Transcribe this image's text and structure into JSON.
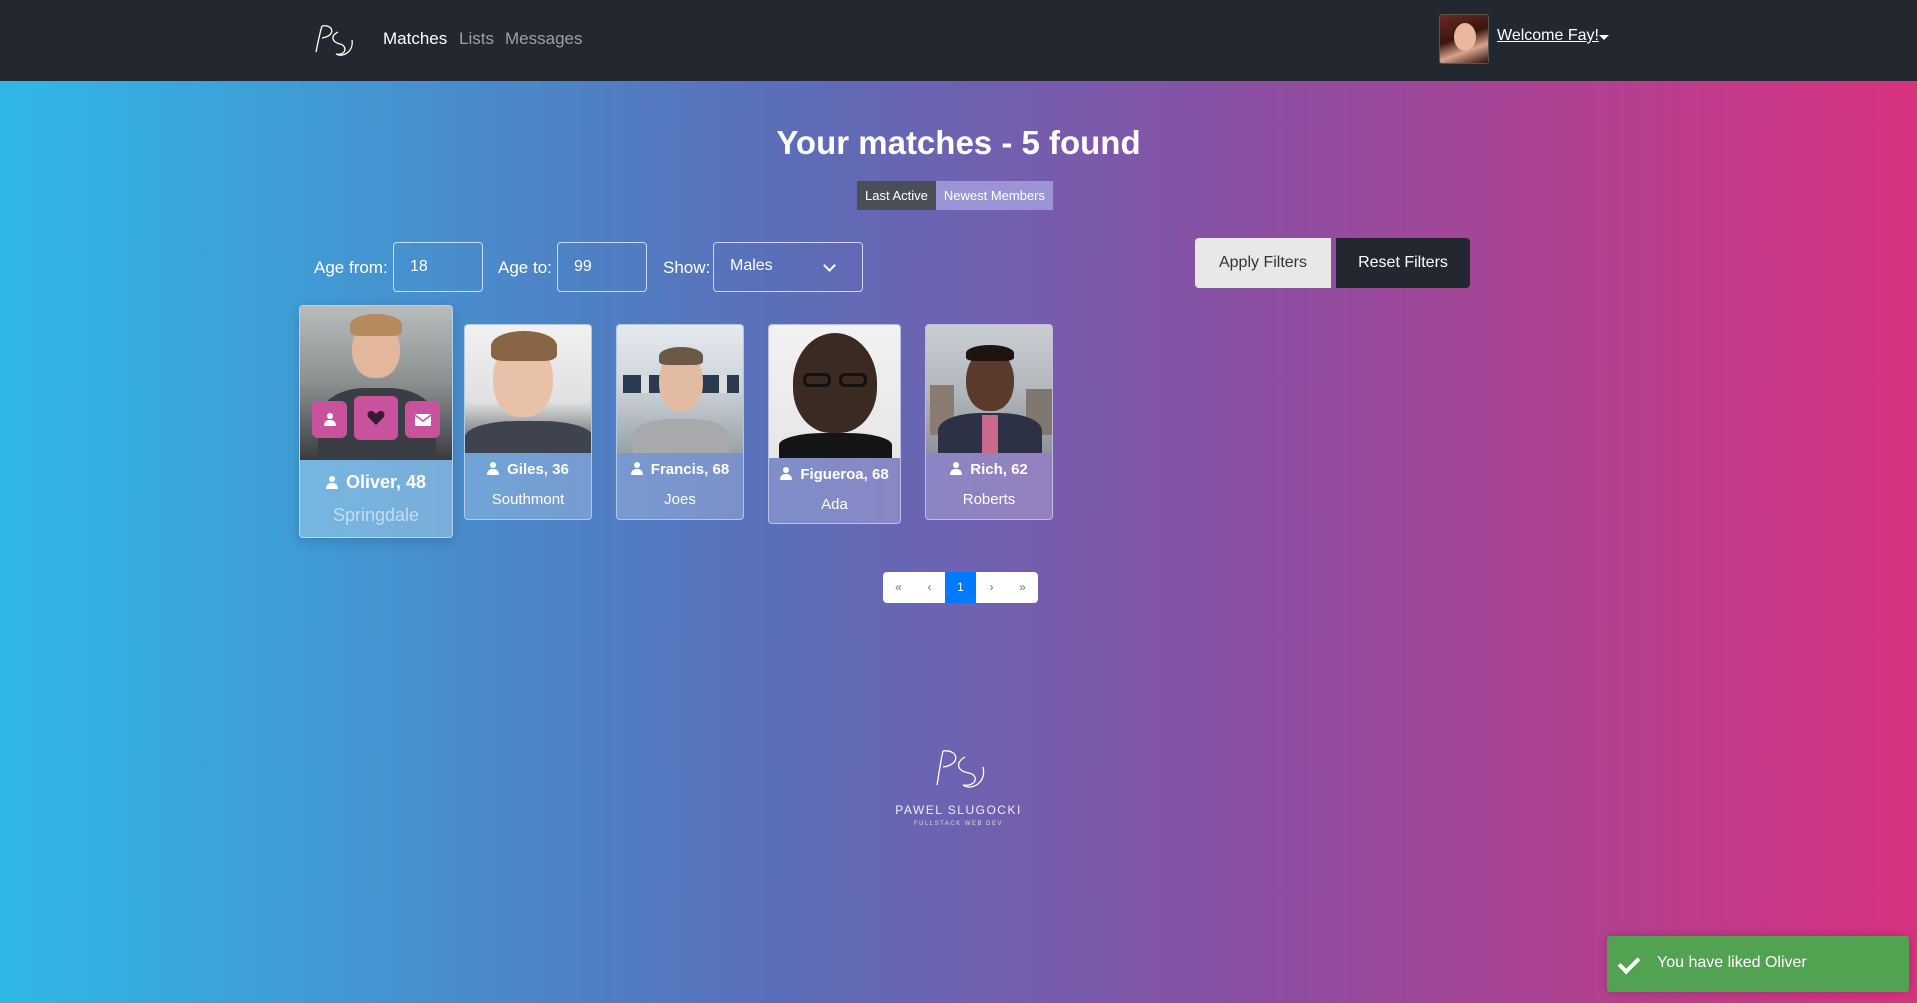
{
  "navbar": {
    "brand_logo": "PS signature logo",
    "links": [
      {
        "label": "Matches",
        "active": true
      },
      {
        "label": "Lists",
        "active": false
      },
      {
        "label": "Messages",
        "active": false
      }
    ],
    "welcome": "Welcome Fay!"
  },
  "page": {
    "title": "Your matches - 5 found",
    "sort_options": [
      "Last Active",
      "Newest Members"
    ]
  },
  "filters": {
    "age_from_label": "Age from:",
    "age_from_value": "18",
    "age_to_label": "Age to:",
    "age_to_value": "99",
    "show_label": "Show:",
    "show_value": "Males",
    "apply_label": "Apply Filters",
    "reset_label": "Reset Filters"
  },
  "members": [
    {
      "name": "Oliver, 48",
      "city": "Springdale"
    },
    {
      "name": "Giles, 36",
      "city": "Southmont"
    },
    {
      "name": "Francis, 68",
      "city": "Joes"
    },
    {
      "name": "Figueroa, 68",
      "city": "Ada"
    },
    {
      "name": "Rich, 62",
      "city": "Roberts"
    }
  ],
  "card_actions": [
    "user-icon",
    "heart-icon",
    "envelope-icon"
  ],
  "pagination": {
    "first": "«",
    "prev": "‹",
    "current": "1",
    "next": "›",
    "last": "»"
  },
  "footer": {
    "name": "PAWEL SLUGOCKI",
    "subtitle": "FULLSTACK WEB DEV"
  },
  "toast": {
    "message": "You have liked Oliver",
    "color": "#51a351"
  },
  "colors": {
    "navbar": "#232730",
    "gradient_start": "#2fb8e6",
    "gradient_end": "#d8327f",
    "action_button": "#c8539c",
    "page_active": "#007bff"
  }
}
